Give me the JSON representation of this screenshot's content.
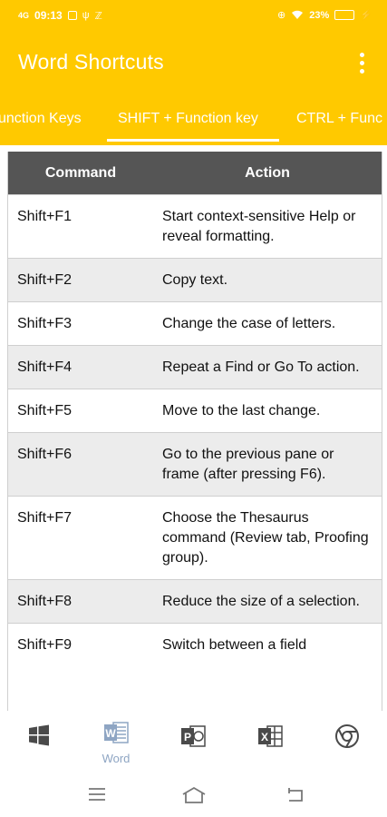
{
  "status": {
    "time": "09:13",
    "network": "4G",
    "battery_percent": "23%"
  },
  "appbar": {
    "title": "Word Shortcuts"
  },
  "tabs": [
    {
      "label": "Function Keys",
      "visible_label": "unction Keys"
    },
    {
      "label": "SHIFT + Function key",
      "active": true
    },
    {
      "label": "CTRL + Function key",
      "visible_label": "CTRL + Func"
    }
  ],
  "table": {
    "headers": {
      "command": "Command",
      "action": "Action"
    },
    "rows": [
      {
        "command": "Shift+F1",
        "action": "Start context-sensitive Help or reveal formatting."
      },
      {
        "command": "Shift+F2",
        "action": "Copy text."
      },
      {
        "command": "Shift+F3",
        "action": "Change the case of letters."
      },
      {
        "command": "Shift+F4",
        "action": "Repeat a Find or Go To action."
      },
      {
        "command": "Shift+F5",
        "action": "Move to the last change."
      },
      {
        "command": "Shift+F6",
        "action": "Go to the previous pane or frame (after pressing F6)."
      },
      {
        "command": "Shift+F7",
        "action": "Choose the Thesaurus command (Review tab, Proofing group)."
      },
      {
        "command": "Shift+F8",
        "action": "Reduce the size of a selection."
      },
      {
        "command": "Shift+F9",
        "action": "Switch between a field"
      }
    ]
  },
  "bottom_nav": [
    {
      "icon": "windows-icon",
      "label": ""
    },
    {
      "icon": "word-icon",
      "label": "Word",
      "active": true
    },
    {
      "icon": "powerpoint-icon",
      "label": ""
    },
    {
      "icon": "excel-icon",
      "label": ""
    },
    {
      "icon": "chrome-icon",
      "label": ""
    }
  ],
  "colors": {
    "appbar": "#FFC900",
    "header_row": "#555555",
    "stripe": "#ececec",
    "nav_active": "#8ea5c3",
    "nav_icon": "#4a4a4a"
  }
}
